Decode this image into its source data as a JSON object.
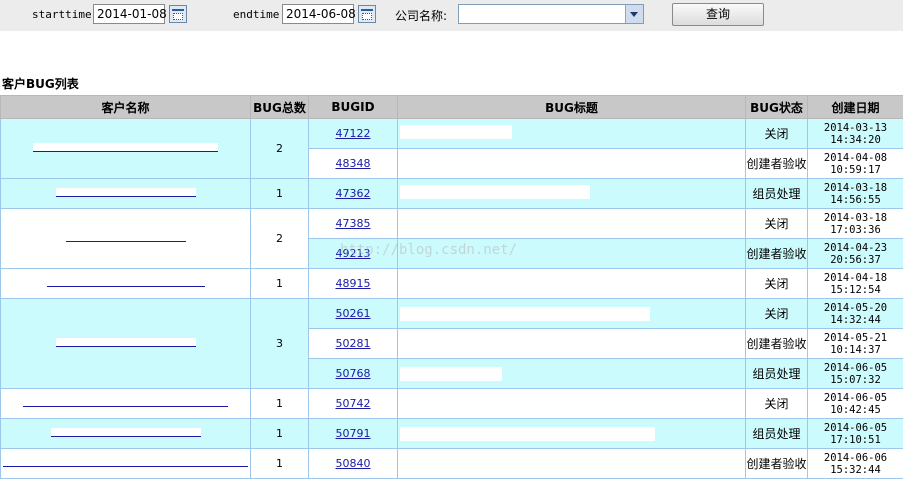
{
  "filters": {
    "start_label": "starttime:",
    "start_value": "2014-01-08",
    "end_label": "endtime:",
    "end_value": "2014-06-08",
    "company_label": "公司名称:",
    "company_value": "",
    "query_button": "查询"
  },
  "section_title": "客户BUG列表",
  "table": {
    "headers": [
      "客户名称",
      "BUG总数",
      "BUGID",
      "BUG标题",
      "BUG状态",
      "创建日期"
    ],
    "groups": [
      {
        "count": "2",
        "bugs": [
          {
            "id": "47122",
            "status": "关闭",
            "date": "2014-03-13",
            "time": "14:34:20"
          },
          {
            "id": "48348",
            "status": "创建者验收",
            "date": "2014-04-08",
            "time": "10:59:17"
          }
        ]
      },
      {
        "count": "1",
        "bugs": [
          {
            "id": "47362",
            "status": "组员处理",
            "date": "2014-03-18",
            "time": "14:56:55"
          }
        ]
      },
      {
        "count": "2",
        "bugs": [
          {
            "id": "47385",
            "status": "关闭",
            "date": "2014-03-18",
            "time": "17:03:36"
          },
          {
            "id": "49213",
            "status": "创建者验收",
            "date": "2014-04-23",
            "time": "20:56:37"
          }
        ]
      },
      {
        "count": "1",
        "bugs": [
          {
            "id": "48915",
            "status": "关闭",
            "date": "2014-04-18",
            "time": "15:12:54"
          }
        ]
      },
      {
        "count": "3",
        "bugs": [
          {
            "id": "50261",
            "status": "关闭",
            "date": "2014-05-20",
            "time": "14:32:44"
          },
          {
            "id": "50281",
            "status": "创建者验收",
            "date": "2014-05-21",
            "time": "10:14:37"
          },
          {
            "id": "50768",
            "status": "组员处理",
            "date": "2014-06-05",
            "time": "15:07:32"
          }
        ]
      },
      {
        "count": "1",
        "bugs": [
          {
            "id": "50742",
            "status": "关闭",
            "date": "2014-06-05",
            "time": "10:42:45"
          }
        ]
      },
      {
        "count": "1",
        "bugs": [
          {
            "id": "50791",
            "status": "组员处理",
            "date": "2014-06-05",
            "time": "17:10:51"
          }
        ]
      },
      {
        "count": "1",
        "bugs": [
          {
            "id": "50840",
            "status": "创建者验收",
            "date": "2014-06-06",
            "time": "15:32:44"
          }
        ]
      }
    ]
  },
  "watermark": "http://blog.csdn.net/"
}
